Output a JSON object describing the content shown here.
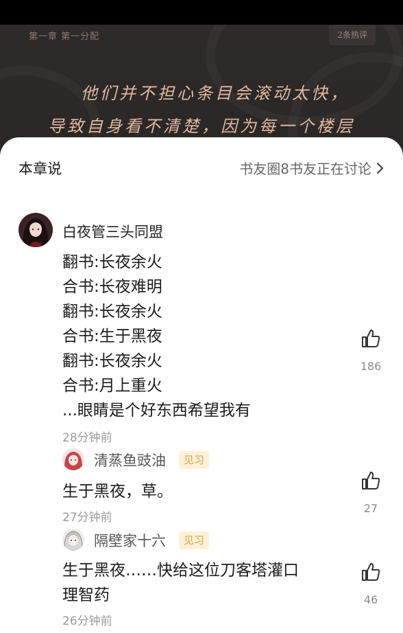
{
  "reader": {
    "chapter_meta": "第一章 第一分配",
    "hot_badge": "2条热评",
    "line1": "他们并不担心条目会滚动太快，",
    "line2": "导致自身看不清楚，因为每一个楼层"
  },
  "sheet": {
    "title": "本章说",
    "discussion_link": "书友圈8书友正在讨论"
  },
  "main_comment": {
    "username": "白夜管三头同盟",
    "lines": [
      "翻书:长夜余火",
      "合书:长夜难明",
      "翻书:长夜余火",
      "合书:生于黑夜",
      "翻书:长夜余火",
      "合书:月上重火",
      "...眼睛是个好东西希望我有"
    ],
    "time": "28分钟前",
    "likes": "186"
  },
  "replies": [
    {
      "username": "清蒸鱼豉油",
      "level": "见习",
      "lines": [
        "生于黑夜，草。"
      ],
      "time": "27分钟前",
      "likes": "27"
    },
    {
      "username": "隔壁家十六",
      "level": "见习",
      "lines": [
        "生于黑夜……快给这位刀客塔灌口",
        "理智药"
      ],
      "time": "26分钟前",
      "likes": "46"
    }
  ],
  "colors": {
    "reader_bg": "#2b2827",
    "reader_text": "#e2b8a1",
    "level_badge_bg": "#fdf1d8",
    "level_badge_text": "#d9a33c"
  },
  "icons": {
    "like": "thumbs-up-icon",
    "chevron": "chevron-right-icon"
  }
}
